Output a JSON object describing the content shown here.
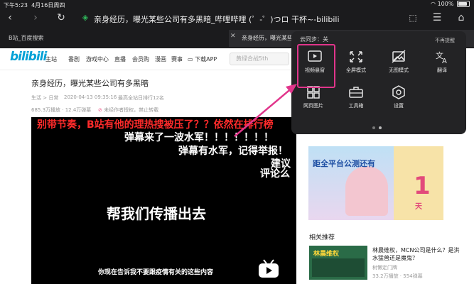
{
  "status_bar": {
    "time": "下午5:23",
    "date": "4月16日周四",
    "battery": "100%",
    "battery_level": 1.0
  },
  "browser": {
    "page_title": "亲身经历，曝光某些公司有多黑暗_哔哩哔哩 (゜-゜)つロ 干杯~-bilibili",
    "tabs": [
      {
        "label": "B站_百度搜索"
      },
      {
        "label": "亲身经历，曝光某些公司有多黑暗_哔哩哔哩 (゜-゜)つロ 干杯~-bilibili"
      }
    ]
  },
  "bilibili": {
    "logo": "bilibili",
    "nav": [
      "主站",
      "番剧",
      "游戏中心",
      "直播",
      "会员购",
      "漫画",
      "赛事",
      "下载APP"
    ],
    "search_placeholder": "黄绿合战5th"
  },
  "article": {
    "title": "亲身经历，曝光某些公司有多黑暗",
    "category": "生活 > 日常",
    "date": "2020-04-13 09:35:16",
    "rank": "最高全站日排行12名",
    "views": "685.3万播放 · 12.4万弹幕",
    "notice": "未经作者授权，禁止转载"
  },
  "video": {
    "danmaku": [
      "别带节奏，B站有他的理热搜被压了？？依然在排行榜",
      "弹幕来了一波水军！！！！！！！",
      "弹幕有水军，记得举报！",
      "建议",
      "评论么"
    ],
    "big_text": "帮我们传播出去",
    "subtitle": "你现在告诉我不要跟疫情有关的这些内容"
  },
  "popup": {
    "title": "云同步：关",
    "dismiss": "不再提醒",
    "items": [
      {
        "label": "视频悬窗",
        "icon": "picture-in-picture-icon"
      },
      {
        "label": "全屏模式",
        "icon": "fullscreen-icon"
      },
      {
        "label": "无图模式",
        "icon": "no-image-icon"
      },
      {
        "label": "翻译",
        "icon": "translate-icon"
      },
      {
        "label": "网页图片",
        "icon": "web-images-icon"
      },
      {
        "label": "工具箱",
        "icon": "toolbox-icon"
      },
      {
        "label": "设置",
        "icon": "settings-icon"
      }
    ]
  },
  "sidebar": {
    "ad_text": "距全平台公测还有",
    "ad_countdown": "1",
    "ad_unit": "天",
    "related_header": "相关推荐",
    "related": [
      {
        "title": "林晨维权，MCN公司是什么？是洪水猛兽还是魔鬼？",
        "author": "树懒定门牌",
        "stats": "33.2万播放 · 554弹幕",
        "thumb_text": "林晨维权"
      }
    ]
  },
  "colors": {
    "accent": "#00a1d6",
    "highlight": "#e1358b",
    "danmaku_red": "#ff2b2b"
  }
}
